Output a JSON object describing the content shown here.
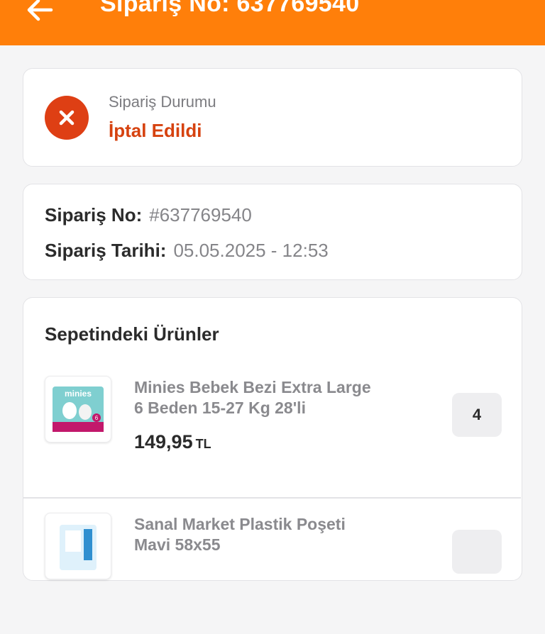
{
  "header": {
    "title": "Sipariş No: 637769540",
    "background": "#ff7f0a",
    "back_icon": "arrow-left-icon"
  },
  "status": {
    "label": "Sipariş Durumu",
    "value": "İptal Edildi",
    "icon": "cancel-x-icon",
    "color": "#d6420f"
  },
  "order_info": {
    "number_label": "Sipariş No:",
    "number_value": "#637769540",
    "date_label": "Sipariş Tarihi:",
    "date_value": "05.05.2025 - 12:53"
  },
  "products": {
    "title": "Sepetindeki Ürünler",
    "items": [
      {
        "name_line1": "Minies Bebek Bezi Extra Large",
        "name_line2": "6 Beden 15-27 Kg 28'li",
        "price": "149,95",
        "currency": "TL",
        "quantity": "4",
        "thumb_brand": "minies",
        "thumb_size": "6"
      },
      {
        "name_line1": "Sanal Market Plastik Poşeti",
        "name_line2": "Mavi 58x55",
        "price": "",
        "currency": "",
        "quantity": "",
        "thumb_brand": "",
        "thumb_size": ""
      }
    ]
  }
}
